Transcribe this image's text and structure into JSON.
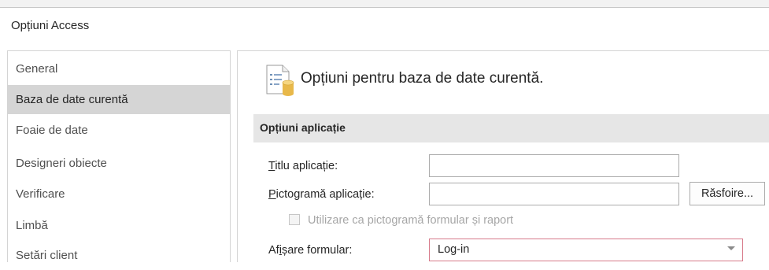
{
  "window": {
    "title": "Opțiuni Access"
  },
  "sidebar": {
    "items": [
      {
        "label": "General",
        "selected": false
      },
      {
        "label": "Baza de date curentă",
        "selected": true
      },
      {
        "label": "Foaie de date",
        "selected": false
      },
      {
        "label": "Designeri obiecte",
        "selected": false
      },
      {
        "label": "Verificare",
        "selected": false
      },
      {
        "label": "Limbă",
        "selected": false
      },
      {
        "label": "Setări client",
        "selected": false
      }
    ]
  },
  "main": {
    "header_icon": "database-options-icon",
    "header": "Opțiuni pentru baza de date curentă.",
    "section_title": "Opțiuni aplicație",
    "app_title": {
      "label_first": "T",
      "label_rest": "itlu aplicație:",
      "value": ""
    },
    "app_icon": {
      "label_first": "P",
      "label_rest": "ictogramă aplicație:",
      "value": "",
      "browse_label": "Răsfoire..."
    },
    "use_as_icon": {
      "label": "Utilizare ca pictogramă formular și raport",
      "checked": false,
      "disabled": true
    },
    "display_form": {
      "label_pre": "Af",
      "label_u": "i",
      "label_rest": "șare formular:",
      "value": "Log-in"
    }
  },
  "colors": {
    "selected_bg": "#d5d5d5",
    "section_bg": "#e6e6e6",
    "focus_border": "#d77a8a"
  }
}
